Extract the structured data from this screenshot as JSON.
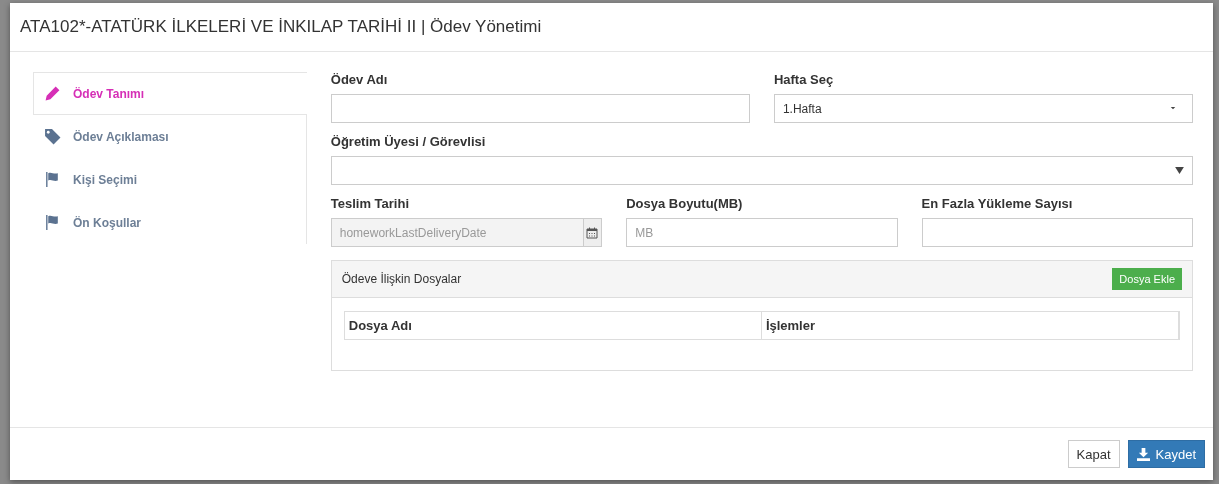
{
  "window": {
    "title": "ATA102*-ATATÜRK İLKELERİ VE İNKILAP TARİHİ II | Ödev Yönetimi"
  },
  "tabs": [
    {
      "label": "Ödev Tanımı",
      "selected": true,
      "kind": "edit"
    },
    {
      "label": "Ödev Açıklaması",
      "selected": false,
      "kind": "tag"
    },
    {
      "label": "Kişi Seçimi",
      "selected": false,
      "kind": "flag"
    },
    {
      "label": "Ön Koşullar",
      "selected": false,
      "kind": "flag"
    }
  ],
  "form": {
    "homework_name": {
      "label": "Ödev Adı"
    },
    "week": {
      "label": "Hafta Seç",
      "value": "1.Hafta"
    },
    "instructor": {
      "label": "Öğretim Üyesi / Görevlisi"
    },
    "due_date": {
      "label": "Teslim Tarihi",
      "placeholder": "homeworkLastDeliveryDate"
    },
    "file_size": {
      "label": "Dosya Boyutu(MB)",
      "placeholder": "MB"
    },
    "max_uploads": {
      "label": "En Fazla Yükleme Sayısı"
    }
  },
  "files_panel": {
    "title": "Ödeve İlişkin Dosyalar",
    "add_button": "Dosya Ekle",
    "columns": [
      "Dosya Adı",
      "İşlemler"
    ]
  },
  "buttons": {
    "close": "Kapat",
    "save": "Kaydet"
  }
}
